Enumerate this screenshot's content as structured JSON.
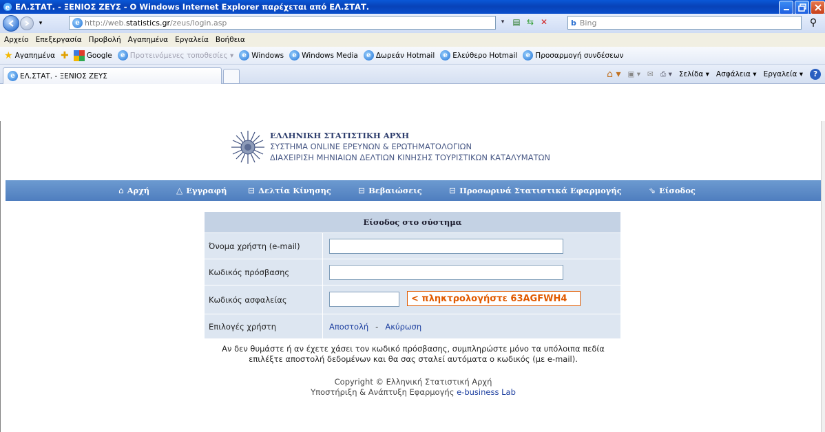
{
  "window": {
    "title": "ΕΛ.ΣΤΑΤ. - ΞΕΝΙΟΣ ΖΕΥΣ - Ο Windows Internet Explorer παρέχεται από ΕΛ.ΣΤΑΤ."
  },
  "address": {
    "url_prefix": "http://web.",
    "url_host": "statistics.gr",
    "url_path": "/zeus/login.asp",
    "search_placeholder": "Bing"
  },
  "menu": [
    "Αρχείο",
    "Επεξεργασία",
    "Προβολή",
    "Αγαπημένα",
    "Εργαλεία",
    "Βοήθεια"
  ],
  "favorites": {
    "label": "Αγαπημένα",
    "items": [
      {
        "label": "Google",
        "icon": "google-icon",
        "dim": false
      },
      {
        "label": "Προτεινόμενες τοποθεσίες ▾",
        "icon": "ie-icon",
        "dim": true
      },
      {
        "label": "Windows",
        "icon": "ie-icon",
        "dim": false
      },
      {
        "label": "Windows Media",
        "icon": "ie-icon",
        "dim": false
      },
      {
        "label": "Δωρεάν Hotmail",
        "icon": "ie-icon",
        "dim": false
      },
      {
        "label": "Ελεύθερο Hotmail",
        "icon": "ie-icon",
        "dim": false
      },
      {
        "label": "Προσαρμογή συνδέσεων",
        "icon": "ie-icon",
        "dim": false
      }
    ]
  },
  "tab": {
    "label": "ΕΛ.ΣΤΑΤ. - ΞΕΝΙΟΣ ΖΕΥΣ"
  },
  "commands": {
    "page": "Σελίδα ▾",
    "safety": "Ασφάλεια ▾",
    "tools": "Εργαλεία ▾"
  },
  "header": {
    "org": "ΕΛΛΗΝΙΚΗ ΣΤΑΤΙΣΤΙΚΗ ΑΡΧΗ",
    "line2": "ΣΥΣΤΗΜΑ ONLINE ΕΡΕΥΝΩΝ & ΕΡΩΤΗΜΑΤΟΛΟΓΙΩΝ",
    "line3": "ΔΙΑΧΕΙΡΙΣΗ ΜΗΝΙΑΙΩΝ ΔΕΛΤΙΩΝ ΚΙΝΗΣΗΣ ΤΟΥΡΙΣΤΙΚΩΝ ΚΑΤΑΛΥΜΑΤΩΝ"
  },
  "nav": {
    "home": "Αρχή",
    "register": "Εγγραφή",
    "movement": "Δελτία Κίνησης",
    "certificates": "Βεβαιώσεις",
    "temp_stats": "Προσωρινά Στατιστικά Εφαρμογής",
    "login": "Είσοδος"
  },
  "login": {
    "heading": "Είσοδος στο σύστημα",
    "username_label": "Όνομα χρήστη (e-mail)",
    "username_value": "",
    "password_label": "Κωδικός πρόσβασης",
    "password_value": "",
    "security_label": "Κωδικός ασφαλείας",
    "security_value": "",
    "captcha_hint": "< πληκτρολογήστε 63AGFWH4",
    "options_label": "Επιλογές χρήστη",
    "send": "Αποστολή",
    "separator": "-",
    "cancel": "Ακύρωση"
  },
  "note": {
    "line1": "Αν δεν θυμάστε ή αν έχετε χάσει τον κωδικό πρόσβασης, συμπληρώστε μόνο τα υπόλοιπα πεδία",
    "line2": "επιλέξτε αποστολή δεδομένων και θα σας σταλεί αυτόματα ο κωδικός (με e-mail)."
  },
  "footer": {
    "copyright": "Copyright © Ελληνική Στατιστική Αρχή",
    "support_prefix": "Υποστήριξη & Ανάπτυξη Εφαρμογής",
    "support_link": "e-business Lab"
  },
  "colors": {
    "nav_bg": "#5a88c6",
    "panel_head": "#c4d2e4",
    "panel_row": "#dde6f1",
    "captcha": "#e05a00",
    "link": "#1e40a0"
  }
}
